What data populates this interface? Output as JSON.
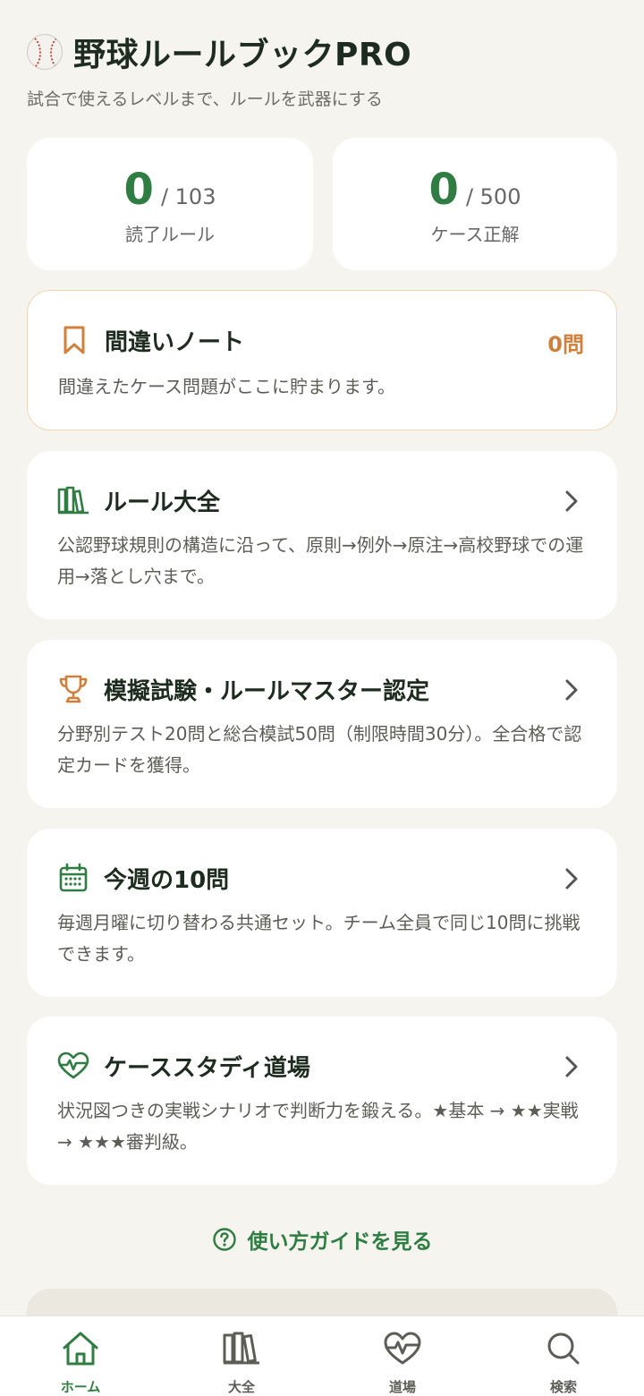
{
  "header": {
    "title": "野球ルールブックPRO",
    "subtitle": "試合で使えるレベルまで、ルールを武器にする"
  },
  "stats": [
    {
      "value": "0",
      "total": "/ 103",
      "label": "読了ルール"
    },
    {
      "value": "0",
      "total": "/ 500",
      "label": "ケース正解"
    }
  ],
  "mistake_note": {
    "title": "間違いノート",
    "count": "0問",
    "description": "間違えたケース問題がここに貯まります。",
    "icon": "bookmark-icon"
  },
  "cards": [
    {
      "title": "ルール大全",
      "description": "公認野球規則の構造に沿って、原則→例外→原注→高校野球での運用→落とし穴まで。",
      "icon": "books-icon"
    },
    {
      "title": "模擬試験・ルールマスター認定",
      "description": "分野別テスト20問と総合模試50問（制限時間30分）。全合格で認定カードを獲得。",
      "icon": "trophy-icon"
    },
    {
      "title": "今週の10問",
      "description": "毎週月曜に切り替わる共通セット。チーム全員で同じ10問に挑戦できます。",
      "icon": "calendar-icon"
    },
    {
      "title": "ケーススタディ道場",
      "description": "状況図つきの実戦シナリオで判断力を鍛える。★基本 → ★★実戦 → ★★★審判級。",
      "icon": "heartbeat-icon"
    }
  ],
  "guide_link": "使い方ガイドを見る",
  "bottom_nav": [
    {
      "label": "ホーム",
      "icon": "home-icon",
      "active": true
    },
    {
      "label": "大全",
      "icon": "books-icon",
      "active": false
    },
    {
      "label": "道場",
      "icon": "heartbeat-icon",
      "active": false
    },
    {
      "label": "検索",
      "icon": "search-icon",
      "active": false
    }
  ],
  "colors": {
    "accent": "#2f7d42",
    "note_accent": "#d0803a",
    "background": "#f5f4ef"
  }
}
